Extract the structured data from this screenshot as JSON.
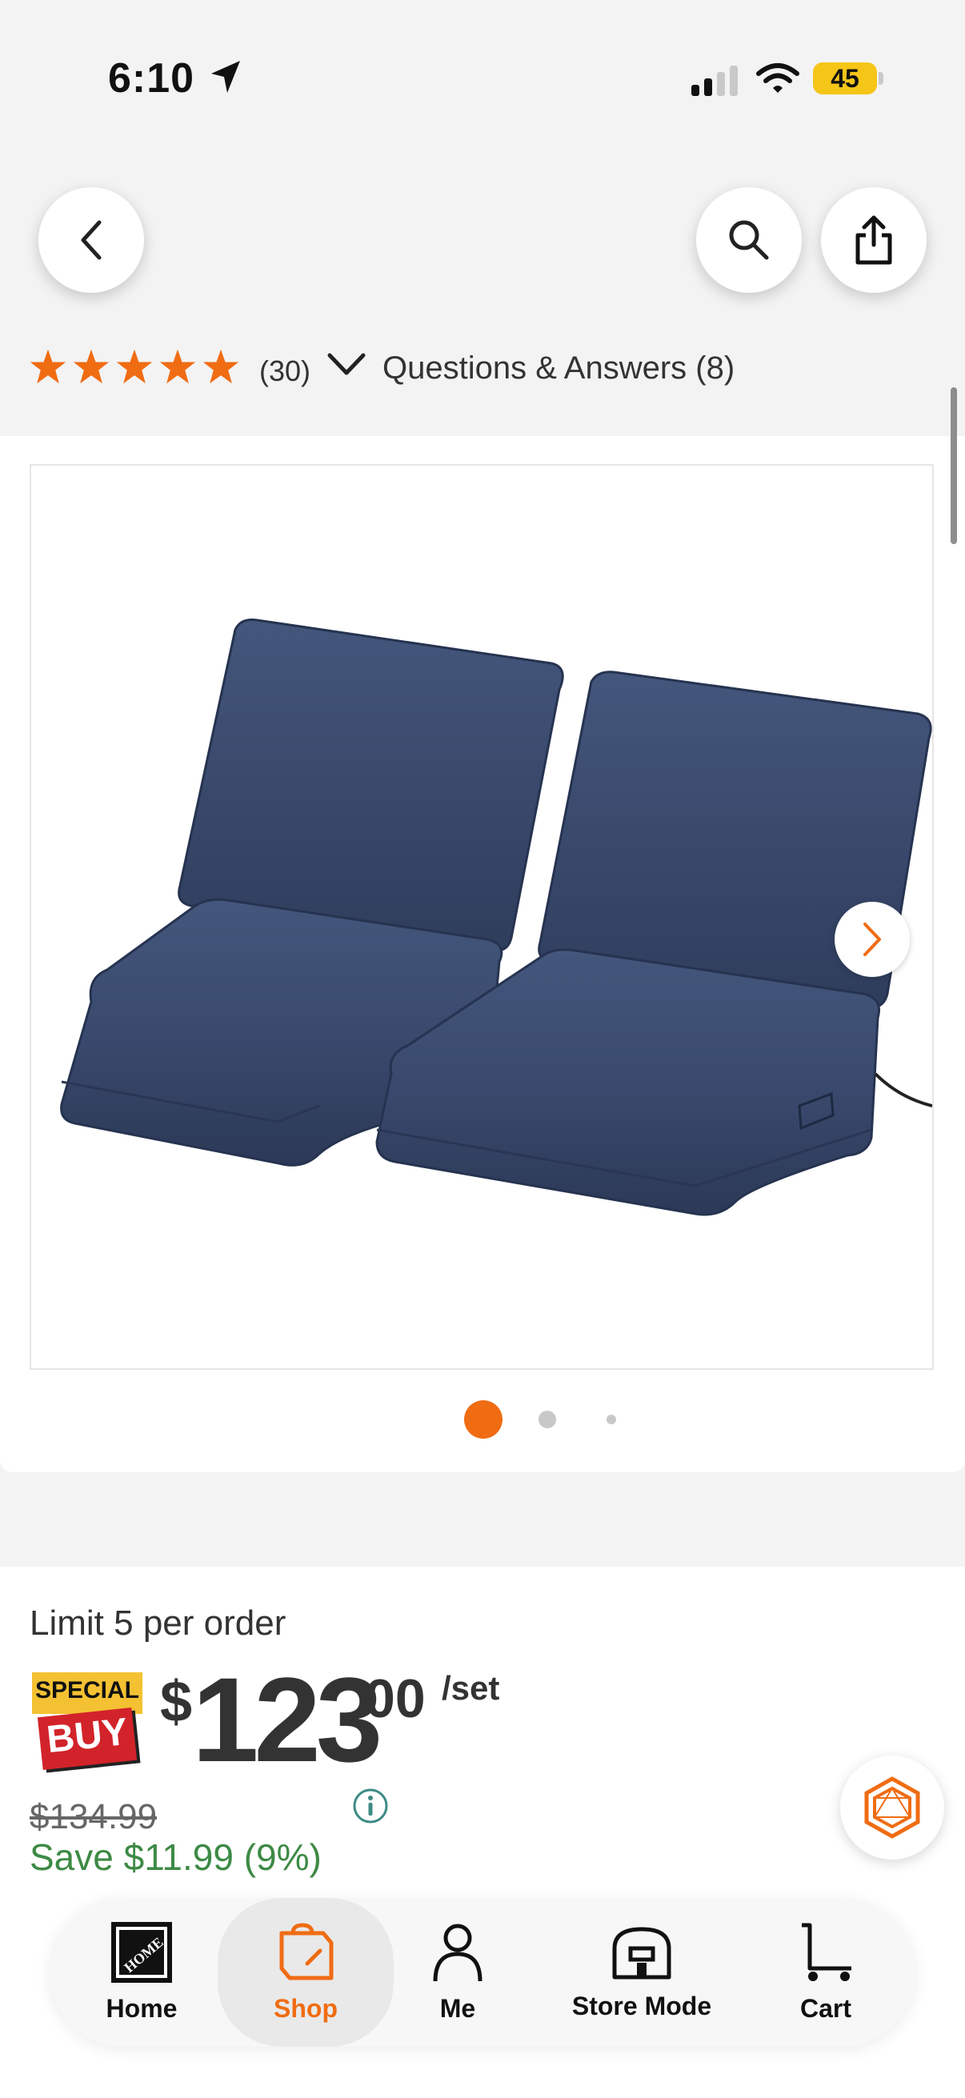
{
  "status_bar": {
    "time": "6:10",
    "battery": "45"
  },
  "rating": {
    "stars": 5,
    "review_count": "(30)",
    "qa_label": "Questions & Answers (8)"
  },
  "gallery": {
    "image_count": 3,
    "active_index": 0
  },
  "price": {
    "limit_text": "Limit 5 per order",
    "badge_top": "SPECIAL",
    "badge_bottom": "BUY",
    "dollar_sign": "$",
    "dollars": "123",
    "cents": "00",
    "unit": "/set",
    "was_price": "$134.99",
    "savings": "Save $11.99 (9%)"
  },
  "nav": {
    "items": [
      {
        "label": "Home"
      },
      {
        "label": "Shop"
      },
      {
        "label": "Me"
      },
      {
        "label": "Store Mode"
      },
      {
        "label": "Cart"
      }
    ],
    "active": "Shop"
  },
  "colors": {
    "accent": "#f06c13",
    "savings_green": "#3d8a45",
    "star": "#f06c13",
    "cushion": "#3a4a6e"
  }
}
